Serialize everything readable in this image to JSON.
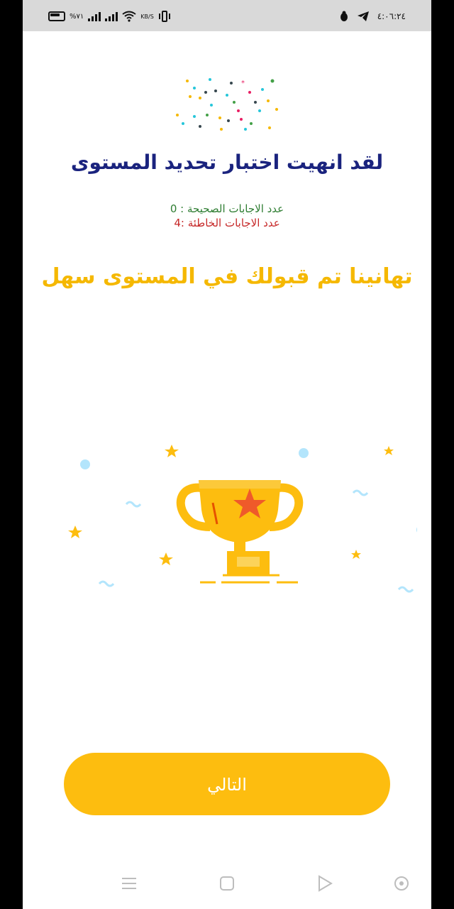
{
  "status_bar": {
    "battery_text": "%٧١",
    "speed_text": "KB/S",
    "time": "٤:٠٦:٢٤"
  },
  "screen": {
    "title": "لقد انهيت اختبار تحديد المستوى",
    "correct_answers": "عدد الاجابات الصحيحة : 0",
    "wrong_answers": "عدد الاجابات الخاطئة :4",
    "congrats_message": "تهانينا تم قبولك في المستوى سهل",
    "next_button_label": "التالي"
  },
  "nav": {
    "items": [
      "menu-icon",
      "home-square-icon",
      "back-triangle-icon",
      "assist-circle-icon"
    ]
  },
  "colors": {
    "accent": "#fdbd0f",
    "title": "#1a237e",
    "correct": "#2e7d32",
    "wrong": "#c62828"
  }
}
